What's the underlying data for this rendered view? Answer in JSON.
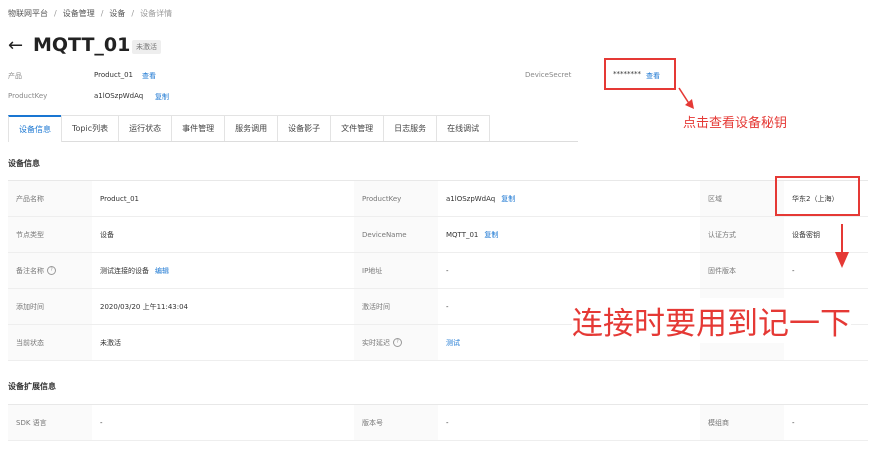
{
  "breadcrumb": [
    "物联网平台",
    "设备管理",
    "设备",
    "设备详情"
  ],
  "page": {
    "back_glyph": "←",
    "title": "MQTT_01",
    "status_badge": "未激活"
  },
  "header": {
    "product_label": "产品",
    "product_value": "Product_01",
    "product_link": "查看",
    "productkey_label": "ProductKey",
    "productkey_value": "a1lOSzpWdAq",
    "productkey_link": "复制",
    "devicesecret_label": "DeviceSecret",
    "devicesecret_value": "********",
    "devicesecret_link": "查看"
  },
  "tabs": [
    "设备信息",
    "Topic列表",
    "运行状态",
    "事件管理",
    "服务调用",
    "设备影子",
    "文件管理",
    "日志服务",
    "在线调试"
  ],
  "active_tab": "设备信息",
  "device_info": {
    "title": "设备信息",
    "rows": [
      {
        "k1": "产品名称",
        "v1": "Product_01",
        "k2": "ProductKey",
        "v2": "a1lOSzpWdAq",
        "v2_link": "复制",
        "k3": "区域",
        "v3": "华东2（上海）"
      },
      {
        "k1": "节点类型",
        "v1": "设备",
        "k2": "DeviceName",
        "v2": "MQTT_01",
        "v2_link": "复制",
        "k3": "认证方式",
        "v3": "设备密钥"
      },
      {
        "k1": "备注名称",
        "v1": "测试连接的设备",
        "v1_link": "编辑",
        "k2": "IP地址",
        "v2": "-",
        "k3": "固件版本",
        "v3": "-"
      },
      {
        "k1": "添加时间",
        "v1": "2020/03/20 上午11:43:04",
        "k2": "激活时间",
        "v2": "-",
        "k3": "",
        "v3": ""
      },
      {
        "k1": "当前状态",
        "v1": "未激活",
        "k2": "实时延迟",
        "v2": "测试",
        "k3": "",
        "v3": ""
      }
    ]
  },
  "ext_info": {
    "title": "设备扩展信息",
    "rows": [
      {
        "k1": "SDK 语言",
        "v1": "-",
        "k2": "版本号",
        "v2": "-",
        "k3": "模组商",
        "v3": "-"
      }
    ]
  },
  "annotations": {
    "secret_note": "点击查看设备秘钥",
    "connect_note": "连接时要用到记一下",
    "color": "#e53935"
  }
}
